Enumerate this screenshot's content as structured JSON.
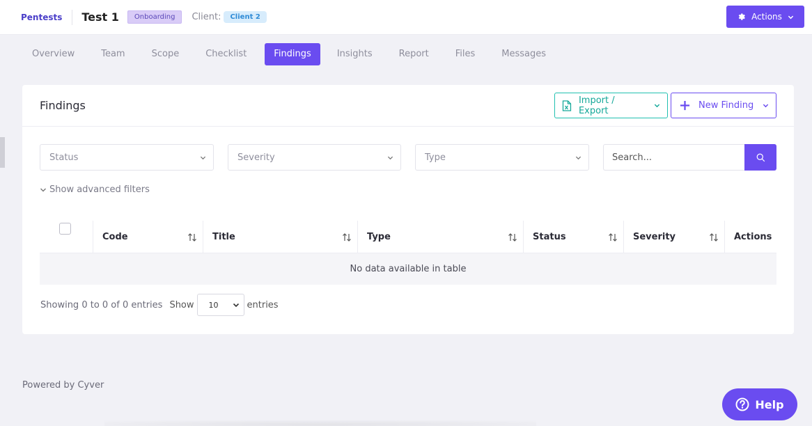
{
  "header": {
    "brand": "Pentests",
    "project_title": "Test 1",
    "status_badge": "Onboarding",
    "client_label": "Client:",
    "client_name": "Client 2",
    "actions_label": "Actions"
  },
  "tabs": [
    {
      "label": "Overview",
      "active": false
    },
    {
      "label": "Team",
      "active": false
    },
    {
      "label": "Scope",
      "active": false
    },
    {
      "label": "Checklist",
      "active": false
    },
    {
      "label": "Findings",
      "active": true
    },
    {
      "label": "Insights",
      "active": false
    },
    {
      "label": "Report",
      "active": false
    },
    {
      "label": "Files",
      "active": false
    },
    {
      "label": "Messages",
      "active": false
    }
  ],
  "card": {
    "title": "Findings",
    "import_export_label": "Import / Export",
    "new_finding_label": "New Finding"
  },
  "filters": {
    "status_placeholder": "Status",
    "severity_placeholder": "Severity",
    "type_placeholder": "Type",
    "search_placeholder": "Search...",
    "advanced_label": "Show advanced filters"
  },
  "table": {
    "columns": [
      "Code",
      "Title",
      "Type",
      "Status",
      "Severity",
      "Actions"
    ],
    "empty_message": "No data available in table"
  },
  "pagination": {
    "showing_text": "Showing 0 to 0 of 0 entries",
    "show_label": "Show",
    "page_length": "10",
    "entries_label": "entries"
  },
  "footer": {
    "powered_by": "Powered by Cyver"
  },
  "help": {
    "label": "Help"
  },
  "colors": {
    "accent": "#6a4cf0",
    "teal": "#14a899",
    "background": "#f1f1f6"
  }
}
